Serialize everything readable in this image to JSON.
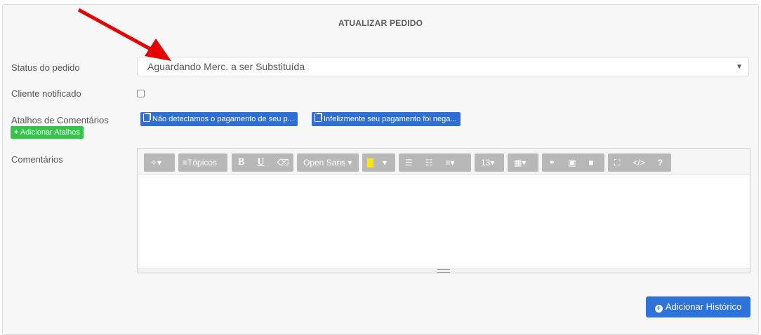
{
  "header": {
    "title": "ATUALIZAR PEDIDO"
  },
  "form": {
    "status": {
      "label": "Status do pedido",
      "value": "Aguardando Merc. a ser Substituída"
    },
    "notified": {
      "label": "Cliente notificado",
      "checked": false
    },
    "shortcuts": {
      "label": "Atalhos de Comentários",
      "items": [
        "Não detectamos o pagamento de seu p...",
        "Infelizmente seu pagamento foi nega..."
      ],
      "add_label": "Adicionar Atalhos"
    },
    "comments": {
      "label": "Comentários"
    }
  },
  "editor_toolbar": {
    "style": "Tópicos",
    "font": "Open Sans",
    "font_size": "13",
    "help": "?",
    "code": "</>"
  },
  "actions": {
    "submit_label": "Adicionar Histórico"
  },
  "colors": {
    "primary": "#2e73d9",
    "success": "#35c44a",
    "arrow": "#e60000",
    "highlight": "#ffe600"
  }
}
